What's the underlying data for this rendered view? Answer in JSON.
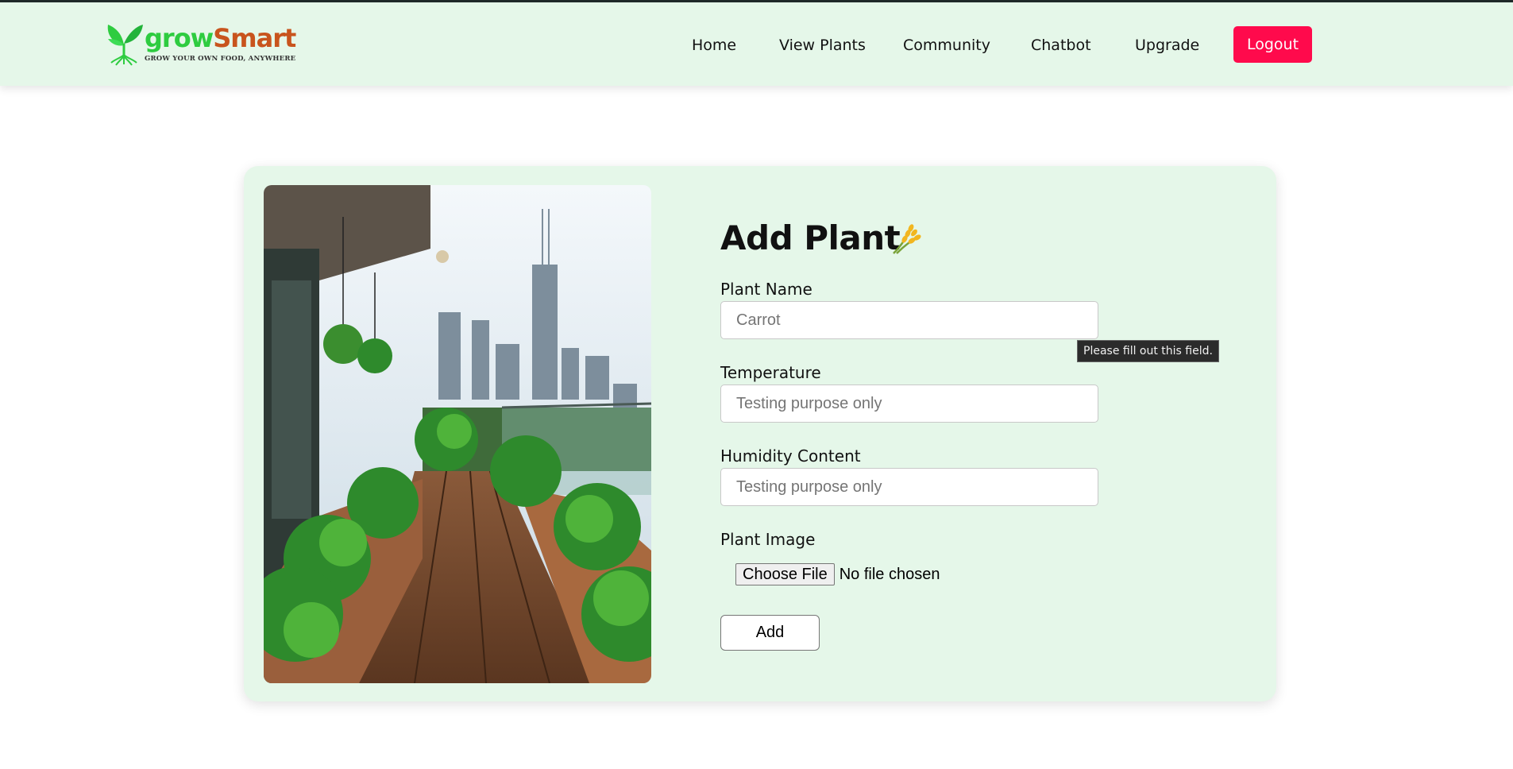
{
  "brand": {
    "name_part1": "grow",
    "name_part2": "Smart",
    "tagline": "GROW YOUR OWN FOOD, ANYWHERE",
    "colors": {
      "green": "#2ecc40",
      "orange": "#c8541d"
    }
  },
  "nav": {
    "items": [
      {
        "label": "Home"
      },
      {
        "label": "View Plants"
      },
      {
        "label": "Community"
      },
      {
        "label": "Chatbot"
      },
      {
        "label": "Upgrade"
      }
    ],
    "logout_label": "Logout",
    "logout_color": "#ff0a4c"
  },
  "form": {
    "title": "Add Plant",
    "title_icon": "wheat-sheaf-icon",
    "fields": {
      "plant_name": {
        "label": "Plant Name",
        "placeholder": "Carrot",
        "value": ""
      },
      "temperature": {
        "label": "Temperature",
        "placeholder": "Testing purpose only",
        "value": ""
      },
      "humidity": {
        "label": "Humidity Content",
        "placeholder": "Testing purpose only",
        "value": ""
      },
      "image": {
        "label": "Plant Image",
        "button_label": "Choose File",
        "status": "No file chosen"
      }
    },
    "submit_label": "Add",
    "validation_tooltip": "Please fill out this field."
  },
  "photo": {
    "icon": "balcony-garden-image"
  },
  "colors": {
    "page_bg": "#ffffff",
    "panel_bg": "#e5f7e9"
  }
}
